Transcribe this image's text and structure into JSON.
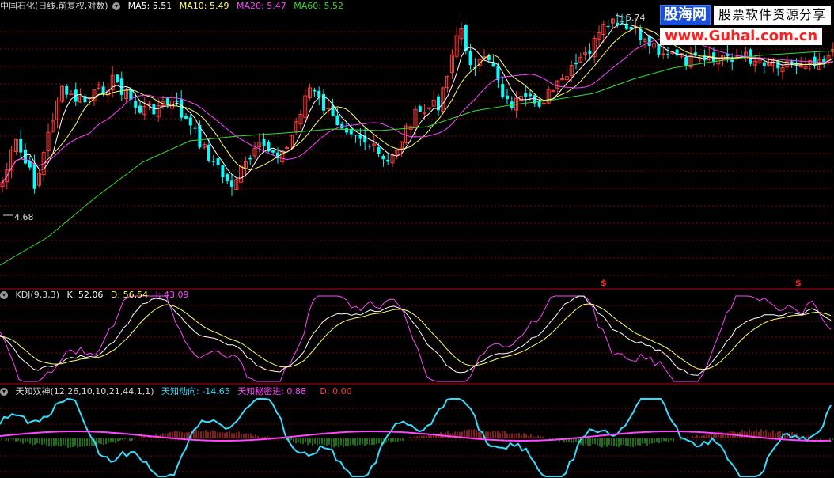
{
  "price": {
    "title": "中国石化(日线,前复权,对数)",
    "ma5": "MA5: 5.51",
    "ma10": "MA10: 5.49",
    "ma20": "MA20: 5.47",
    "ma60": "MA60: 5.52",
    "high_label": "5.74",
    "low_label": "4.68",
    "signal_mark": "$"
  },
  "kdj": {
    "title": "KDJ(9,3,3)",
    "k": "K: 52.06",
    "d": "D: 56.54",
    "j": "J: 43.09"
  },
  "tz": {
    "title": "天知双神(12,26,10,10,21,44,1,1)",
    "dx": "天知动向: -14.65",
    "mj": "天知秘密进: 0.88",
    "d": "D: 0.00"
  },
  "watermark": {
    "logo": "股海网",
    "slogan": "股票软件资源分享",
    "url": "www.Guhai.com.cn"
  },
  "colors": {
    "up": "#ff3c3c",
    "down": "#00ffff",
    "ma5": "#ffffff",
    "ma10": "#ffff66",
    "ma20": "#ff44ff",
    "ma60": "#33dd33",
    "grid": "#8a0000"
  }
}
